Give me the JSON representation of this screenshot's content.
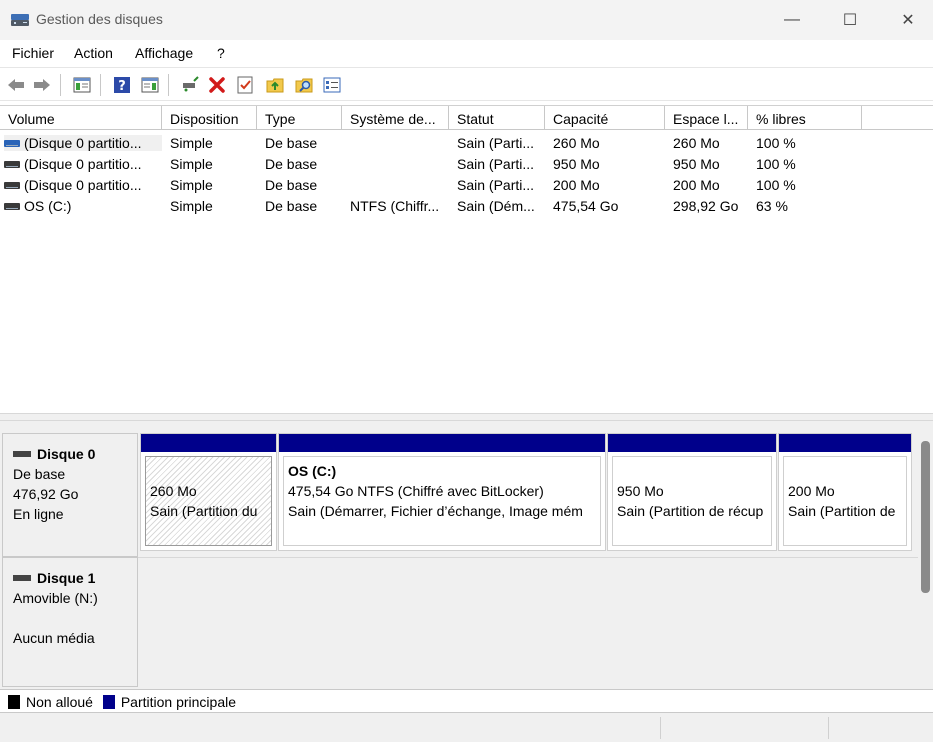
{
  "window": {
    "title": "Gestion des disques",
    "controls": {
      "minimize": "—",
      "maximize": "☐",
      "close": "✕"
    }
  },
  "menu": [
    "Fichier",
    "Action",
    "Affichage",
    "?"
  ],
  "toolbar": {
    "buttons": [
      "back-arrow-icon",
      "forward-arrow-icon",
      "console-tree-icon",
      "help-icon",
      "properties-pane-icon",
      "connect-disk-icon",
      "delete-icon",
      "checklist-icon",
      "folder-up-icon",
      "search-icon",
      "properties-icon"
    ]
  },
  "table": {
    "columns": [
      "Volume",
      "Disposition",
      "Type",
      "Système de...",
      "Statut",
      "Capacité",
      "Espace l...",
      "% libres"
    ],
    "rows": [
      {
        "volume": "(Disque 0 partitio...",
        "disposition": "Simple",
        "type": "De base",
        "fs": "",
        "statut": "Sain (Parti...",
        "capacite": "260 Mo",
        "espace": "260 Mo",
        "libres": "100 %",
        "icon": "blue"
      },
      {
        "volume": "(Disque 0 partitio...",
        "disposition": "Simple",
        "type": "De base",
        "fs": "",
        "statut": "Sain (Parti...",
        "capacite": "950 Mo",
        "espace": "950 Mo",
        "libres": "100 %",
        "icon": "gray"
      },
      {
        "volume": "(Disque 0 partitio...",
        "disposition": "Simple",
        "type": "De base",
        "fs": "",
        "statut": "Sain (Parti...",
        "capacite": "200 Mo",
        "espace": "200 Mo",
        "libres": "100 %",
        "icon": "gray"
      },
      {
        "volume": "OS (C:)",
        "disposition": "Simple",
        "type": "De base",
        "fs": "NTFS (Chiffr...",
        "statut": "Sain (Dém...",
        "capacite": "475,54 Go",
        "espace": "298,92 Go",
        "libres": "63 %",
        "icon": "gray"
      }
    ]
  },
  "disks": [
    {
      "name": "Disque 0",
      "type": "De base",
      "size": "476,92 Go",
      "state": "En ligne",
      "partitions": [
        {
          "name": "",
          "size": "260 Mo",
          "status": "Sain (Partition du"
        },
        {
          "name": "OS  (C:)",
          "size": "475,54 Go NTFS (Chiffré avec BitLocker)",
          "status": "Sain (Démarrer, Fichier d’échange, Image mém"
        },
        {
          "name": "",
          "size": "950 Mo",
          "status": "Sain (Partition de récup"
        },
        {
          "name": "",
          "size": "200 Mo",
          "status": "Sain (Partition de"
        }
      ]
    },
    {
      "name": "Disque 1",
      "type": "Amovible (N:)",
      "size": "",
      "state": "Aucun média"
    }
  ],
  "legend": [
    {
      "label": "Non alloué",
      "color": "#000000"
    },
    {
      "label": "Partition principale",
      "color": "#00008b"
    }
  ]
}
